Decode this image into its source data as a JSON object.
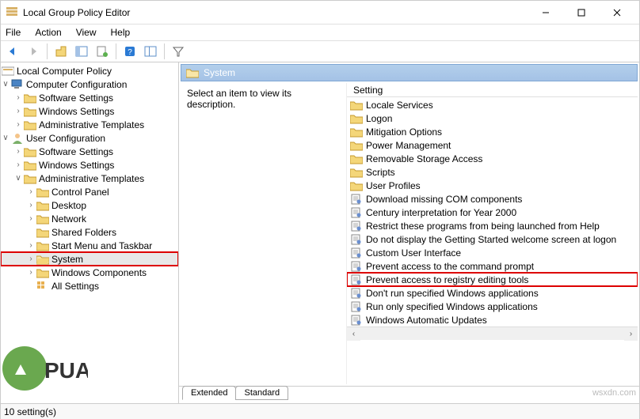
{
  "window": {
    "title": "Local Group Policy Editor"
  },
  "menus": {
    "file": "File",
    "action": "Action",
    "view": "View",
    "help": "Help"
  },
  "tree": {
    "root": "Local Computer Policy",
    "computer_config": "Computer Configuration",
    "cc_software": "Software Settings",
    "cc_windows": "Windows Settings",
    "cc_admin": "Administrative Templates",
    "user_config": "User Configuration",
    "uc_software": "Software Settings",
    "uc_windows": "Windows Settings",
    "uc_admin": "Administrative Templates",
    "control_panel": "Control Panel",
    "desktop": "Desktop",
    "network": "Network",
    "shared_folders": "Shared Folders",
    "startmenu": "Start Menu and Taskbar",
    "system": "System",
    "windows_components": "Windows Components",
    "all_settings": "All Settings"
  },
  "content": {
    "header": "System",
    "description": "Select an item to view its description.",
    "setting_column": "Setting"
  },
  "settings": [
    {
      "type": "folder",
      "label": "Locale Services"
    },
    {
      "type": "folder",
      "label": "Logon"
    },
    {
      "type": "folder",
      "label": "Mitigation Options"
    },
    {
      "type": "folder",
      "label": "Power Management"
    },
    {
      "type": "folder",
      "label": "Removable Storage Access"
    },
    {
      "type": "folder",
      "label": "Scripts"
    },
    {
      "type": "folder",
      "label": "User Profiles"
    },
    {
      "type": "policy",
      "label": "Download missing COM components"
    },
    {
      "type": "policy",
      "label": "Century interpretation for Year 2000"
    },
    {
      "type": "policy",
      "label": "Restrict these programs from being launched from Help"
    },
    {
      "type": "policy",
      "label": "Do not display the Getting Started welcome screen at logon"
    },
    {
      "type": "policy",
      "label": "Custom User Interface"
    },
    {
      "type": "policy",
      "label": "Prevent access to the command prompt"
    },
    {
      "type": "policy",
      "label": "Prevent access to registry editing tools",
      "highlight": true
    },
    {
      "type": "policy",
      "label": "Don't run specified Windows applications"
    },
    {
      "type": "policy",
      "label": "Run only specified Windows applications"
    },
    {
      "type": "policy",
      "label": "Windows Automatic Updates"
    }
  ],
  "tabs": {
    "extended": "Extended",
    "standard": "Standard"
  },
  "status": {
    "count": "10 setting(s)"
  },
  "watermark": "wsxdn.com"
}
